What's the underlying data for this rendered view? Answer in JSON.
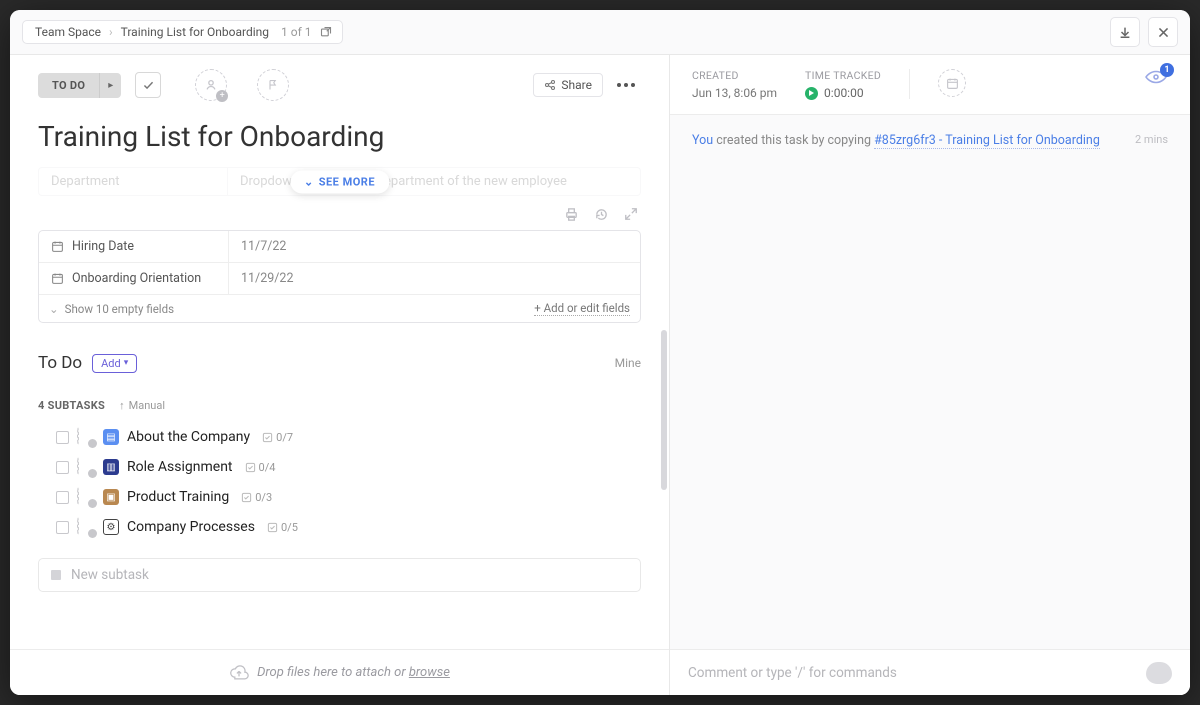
{
  "breadcrumb": {
    "space": "Team Space",
    "item": "Training List for Onboarding",
    "count": "1 of 1"
  },
  "status": {
    "label": "TO DO"
  },
  "share": {
    "label": "Share"
  },
  "title": "Training List for Onboarding",
  "ghost": {
    "label": "Department",
    "desc": "Dropdown to select the department of the new employee"
  },
  "see_more": "SEE MORE",
  "fields": [
    {
      "icon": "calendar",
      "label": "Hiring Date",
      "value": "11/7/22"
    },
    {
      "icon": "calendar",
      "label": "Onboarding Orientation",
      "value": "11/29/22"
    }
  ],
  "fields_footer": {
    "show": "Show 10 empty fields",
    "addedit": "+ Add or edit fields"
  },
  "section": {
    "title": "To Do",
    "add": "Add",
    "mine": "Mine"
  },
  "subtasks_meta": {
    "count_label": "4 SUBTASKS",
    "sort": "Manual"
  },
  "subtasks": [
    {
      "icon": "doc-blue",
      "title": "About the Company",
      "progress": "0/7"
    },
    {
      "icon": "doc-navy",
      "title": "Role Assignment",
      "progress": "0/4"
    },
    {
      "icon": "doc-brown",
      "title": "Product Training",
      "progress": "0/3"
    },
    {
      "icon": "doc-gear",
      "title": "Company Processes",
      "progress": "0/5"
    }
  ],
  "new_subtask_placeholder": "New subtask",
  "drop": {
    "text": "Drop files here to attach or ",
    "link": "browse"
  },
  "meta": {
    "created_label": "CREATED",
    "created_value": "Jun 13, 8:06 pm",
    "tt_label": "TIME TRACKED",
    "tt_value": "0:00:00",
    "watchers": "1"
  },
  "activity": {
    "actor": "You",
    "text": " created this task by copying ",
    "link": "#85zrg6fr3 - Training List for Onboarding",
    "time": "2 mins"
  },
  "comment_placeholder": "Comment or type '/' for commands"
}
